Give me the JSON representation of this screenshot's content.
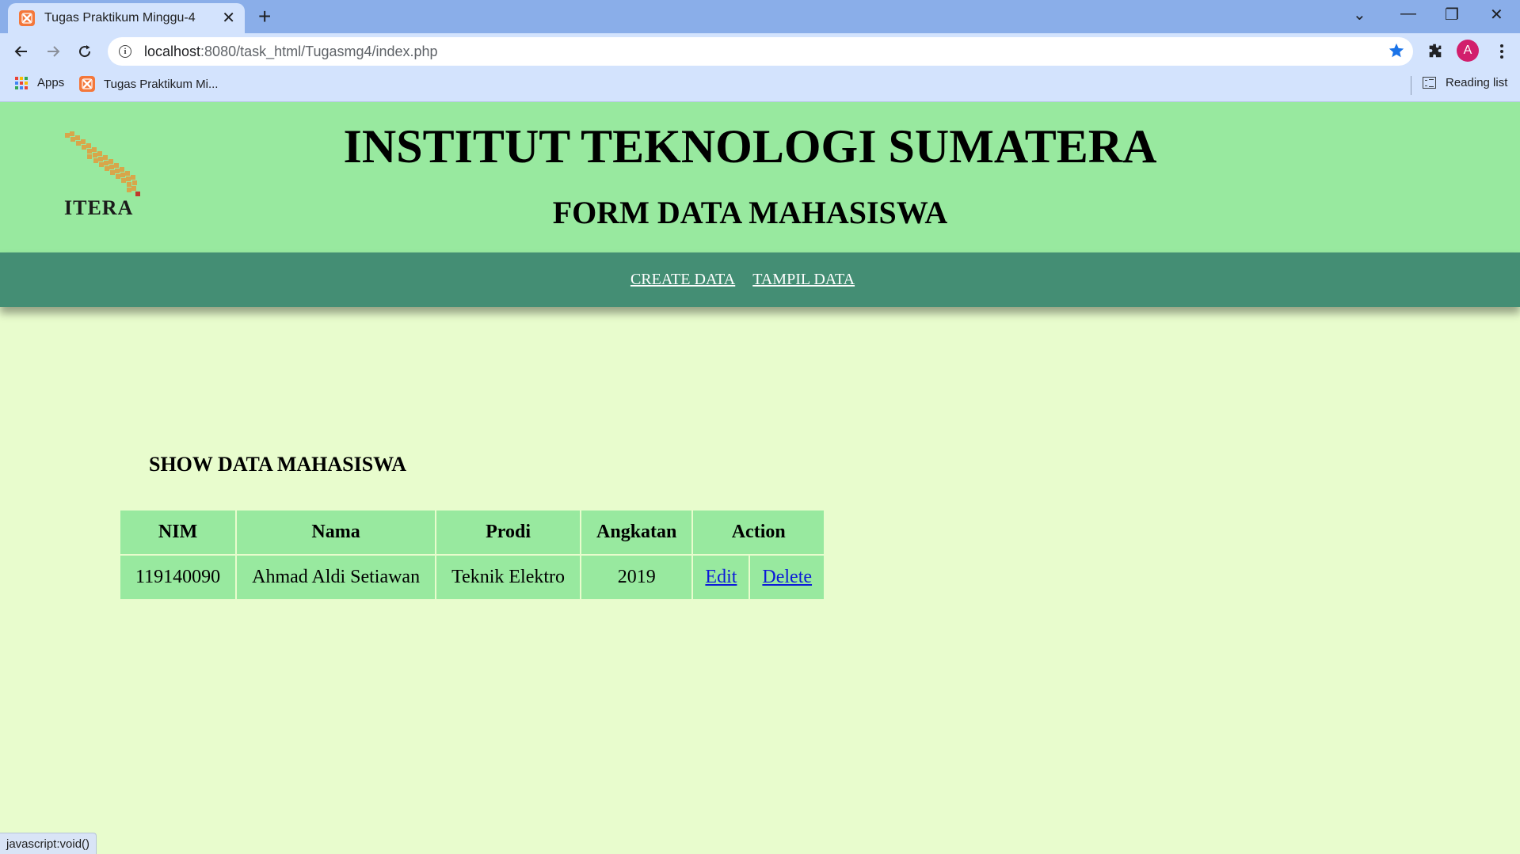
{
  "browser": {
    "tab_title": "Tugas Praktikum Minggu-4",
    "url_host": "localhost",
    "url_path": ":8080/task_html/Tugasmg4/index.php",
    "avatar_letter": "A",
    "bookmarks": [
      {
        "label": "Apps",
        "icon": "apps-grid-icon"
      },
      {
        "label": "Tugas Praktikum Mi...",
        "icon": "xampp-icon"
      }
    ],
    "reading_list": "Reading list",
    "status_text": "javascript:void()"
  },
  "header": {
    "logo_text": "ITERA",
    "title": "INSTITUT TEKNOLOGI SUMATERA",
    "subtitle": "FORM DATA MAHASISWA"
  },
  "nav": {
    "create": "CREATE DATA",
    "show": "TAMPIL DATA"
  },
  "section_title": "SHOW DATA MAHASISWA",
  "table": {
    "headers": [
      "NIM",
      "Nama",
      "Prodi",
      "Angkatan",
      "Action"
    ],
    "rows": [
      {
        "nim": "119140090",
        "nama": "Ahmad Aldi Setiawan",
        "prodi": "Teknik Elektro",
        "angkatan": "2019",
        "edit": "Edit",
        "delete": "Delete"
      }
    ]
  },
  "colors": {
    "header_bg": "#98e99f",
    "nav_bg": "#448e74",
    "page_bg": "#e8fccd",
    "link": "#0c1ad8"
  }
}
